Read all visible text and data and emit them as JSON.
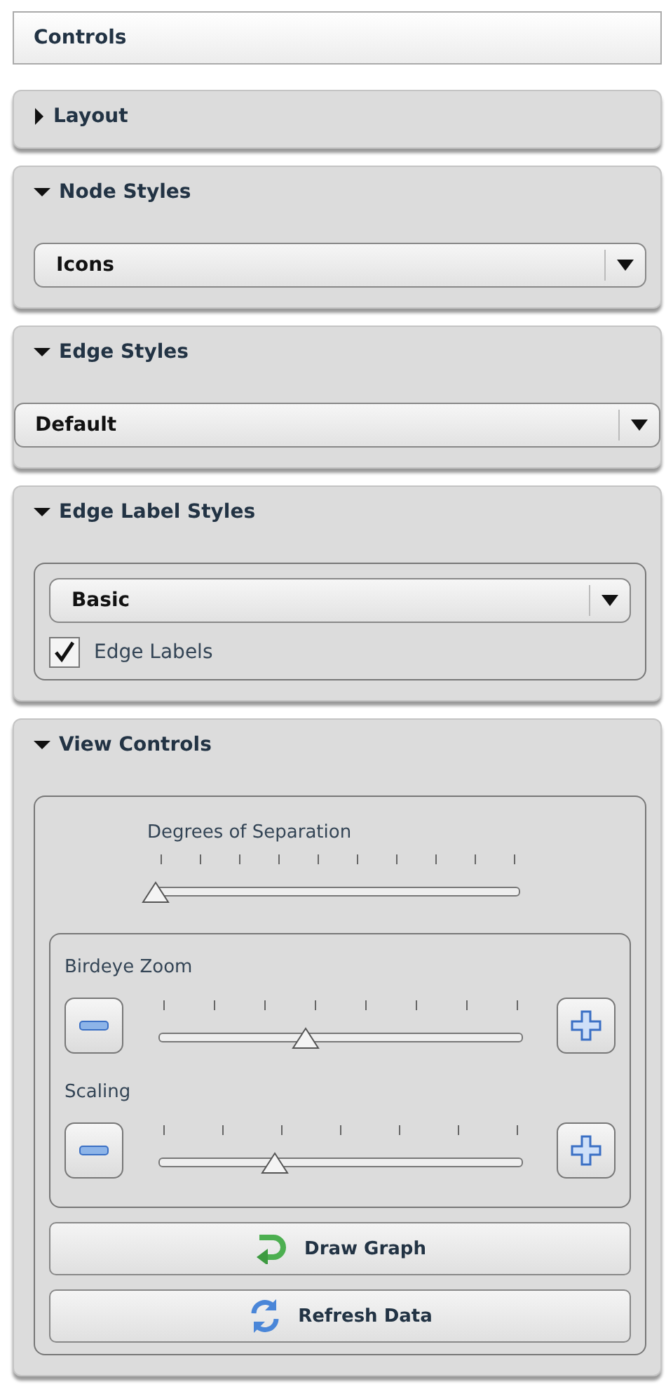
{
  "title": "Controls",
  "sections": [
    {
      "title": "Layout",
      "expanded": false
    },
    {
      "title": "Node Styles",
      "expanded": true,
      "content": [
        {
          "kind": "dropdown",
          "value": "Icons"
        }
      ]
    },
    {
      "title": "Edge Styles",
      "expanded": true,
      "content": [
        {
          "kind": "wide_dropdown",
          "value": "Default"
        }
      ]
    },
    {
      "title": "Edge Label Styles",
      "expanded": true,
      "content": [
        {
          "kind": "group",
          "children": [
            {
              "kind": "dropdown",
              "value": "Basic"
            },
            {
              "kind": "checkbox",
              "label": "Edge Labels",
              "checked": true
            }
          ]
        }
      ]
    },
    {
      "title": "View Controls",
      "expanded": true,
      "content": [
        {
          "kind": "group",
          "children": [
            {
              "kind": "slider",
              "label": "Degrees of Separation",
              "level": 0
            },
            {
              "kind": "group",
              "children": [
                {
                  "kind": "stepper",
                  "label": "Birdeye Zoom",
                  "level": 0.42
                },
                {
                  "kind": "stepper",
                  "label": "Scaling",
                  "level": 0.33
                }
              ]
            },
            {
              "kind": "button",
              "label": "Draw Graph"
            },
            {
              "kind": "button",
              "label": "Refresh Data"
            }
          ]
        }
      ]
    }
  ]
}
